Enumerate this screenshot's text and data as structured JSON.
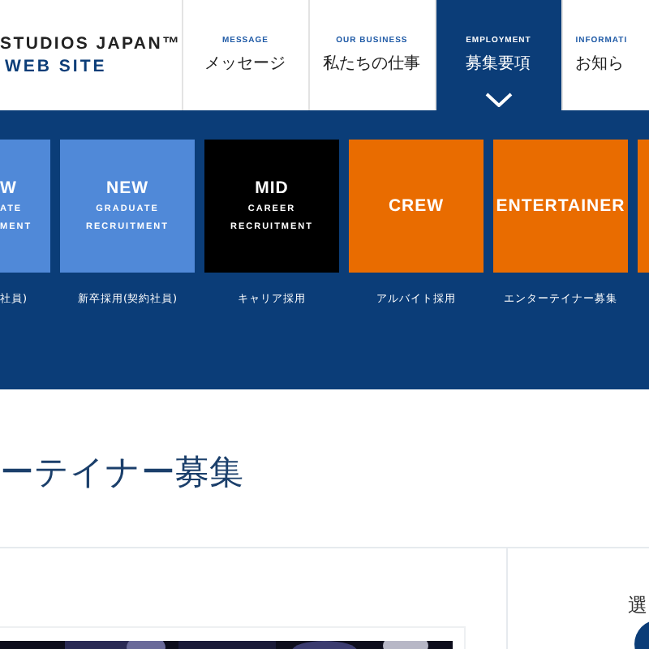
{
  "header": {
    "logo": {
      "title": "STUDIOS JAPAN™",
      "subtitle": "WEB SITE"
    },
    "nav": [
      {
        "en": "MESSAGE",
        "ja": "メッセージ",
        "selected": false
      },
      {
        "en": "OUR BUSINESS",
        "ja": "私たちの仕事",
        "selected": false
      },
      {
        "en": "EMPLOYMENT",
        "ja": "募集要項",
        "selected": true
      },
      {
        "en": "INFORMATI",
        "ja": "お知ら",
        "selected": false
      }
    ]
  },
  "categories": [
    {
      "title": "W",
      "lines": [
        "ATE",
        "MENT"
      ],
      "caption": "社員)",
      "color": "#5089d8"
    },
    {
      "title": "NEW",
      "lines": [
        "GRADUATE",
        "RECRUITMENT"
      ],
      "caption": "新卒採用(契約社員)",
      "color": "#5089d8"
    },
    {
      "title": "MID",
      "lines": [
        "CAREER",
        "RECRUITMENT"
      ],
      "caption": "キャリア採用",
      "color": "#000000"
    },
    {
      "title": "CREW",
      "caption": "アルバイト採用",
      "color": "#e96c00"
    },
    {
      "title": "ENTERTAINER",
      "caption": "エンターテイナー募集",
      "color": "#e96c00"
    },
    {
      "color": "#e96c00"
    }
  ],
  "page_title": "ーテイナー募集",
  "sidebar": {
    "label": "選"
  }
}
